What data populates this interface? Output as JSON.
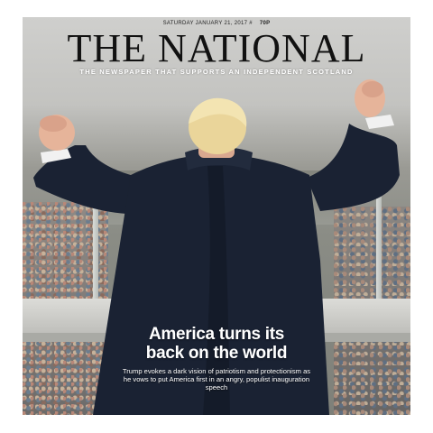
{
  "masthead": {
    "date": "SATURDAY JANUARY 21, 2017",
    "issue": "#",
    "price": "70P",
    "title": "THE NATIONAL",
    "tagline": "THE NEWSPAPER THAT SUPPORTS AN INDEPENDENT SCOTLAND"
  },
  "lead_story": {
    "headline_line1": "America turns its",
    "headline_line2": "back on the world",
    "standfirst": "Trump evokes a dark vision of patriotism and protectionism as he vows to put America first in an angry, populist inauguration speech"
  },
  "colors": {
    "masthead_text": "#111111",
    "coat": "#1a2233",
    "headline_text": "#ffffff"
  }
}
